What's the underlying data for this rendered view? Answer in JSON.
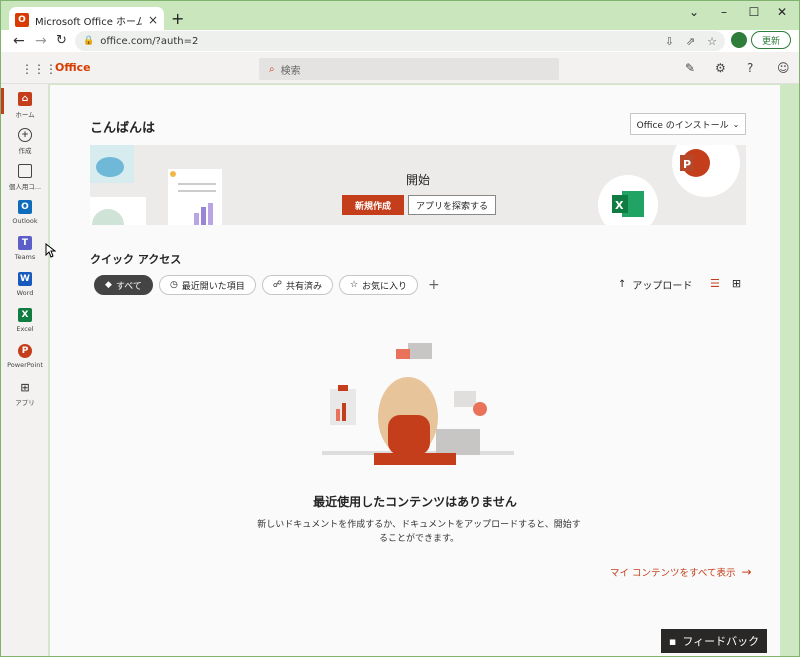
{
  "browser": {
    "tab_title": "Microsoft Office ホーム",
    "tab_close": "×",
    "new_tab": "+",
    "url": "office.com/?auth=2",
    "update_label": "更新",
    "window_controls": [
      "⌄",
      "–",
      "☐",
      "✕"
    ]
  },
  "office": {
    "brand": "Office",
    "search_placeholder": "検索",
    "greeting": "こんばんは",
    "install_label": "Office のインストール",
    "banner": {
      "start_label": "開始",
      "new_button": "新規作成",
      "explore_button": "アプリを探索する"
    },
    "quick_access": "クイック アクセス",
    "filters": [
      "すべて",
      "最近開いた項目",
      "共有済み",
      "お気に入り"
    ],
    "upload_label": "アップロード",
    "empty_title": "最近使用したコンテンツはありません",
    "empty_desc": "新しいドキュメントを作成するか、ドキュメントをアップロードすると、開始することができます。",
    "all_content_link": "マイ コンテンツをすべて表示",
    "feedback_label": "フィードバック"
  },
  "rail": {
    "items": [
      {
        "label": "ホーム",
        "icon": "home-icon",
        "color": "#c43e1c"
      },
      {
        "label": "作成",
        "icon": "create-icon",
        "color": "#444444"
      },
      {
        "label": "個人用コ...",
        "icon": "folder-icon",
        "color": "#444444"
      },
      {
        "label": "Outlook",
        "icon": "outlook-icon",
        "color": "#0f6cbd"
      },
      {
        "label": "Teams",
        "icon": "teams-icon",
        "color": "#5b5fc7"
      },
      {
        "label": "Word",
        "icon": "word-icon",
        "color": "#185abd"
      },
      {
        "label": "Excel",
        "icon": "excel-icon",
        "color": "#107c41"
      },
      {
        "label": "PowerPoint",
        "icon": "powerpoint-icon",
        "color": "#c43e1c"
      },
      {
        "label": "アプリ",
        "icon": "apps-icon",
        "color": "#444444"
      }
    ]
  }
}
